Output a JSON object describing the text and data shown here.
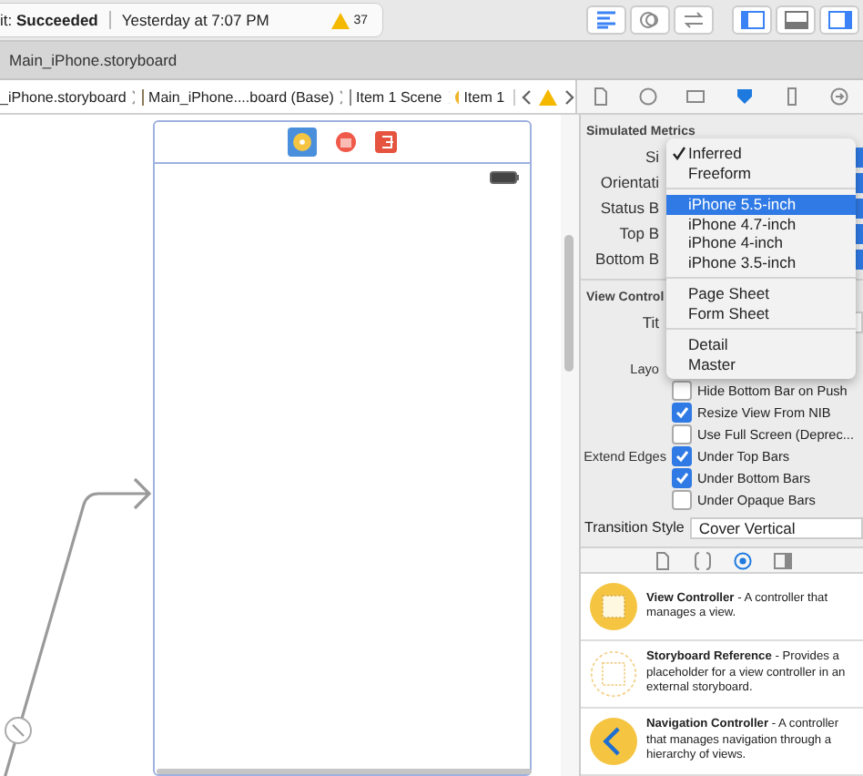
{
  "toolbar": {
    "status": "it: **Succeeded**",
    "time": "Yesterday at 7:07 PM",
    "warning_count": "37",
    "editor_buttons": [
      {
        "selected": true
      },
      {
        "selected": false
      },
      {
        "selected": false
      }
    ],
    "view_buttons": [
      {
        "selected": true
      },
      {
        "selected": false
      },
      {
        "selected": true
      }
    ]
  },
  "tab": {
    "title": "Main_iPhone.storyboard"
  },
  "jump_bar": [
    {
      "label": "_iPhone.storyboard",
      "kind": "file"
    },
    {
      "label": "Main_iPhone....board (Base)",
      "kind": "doc"
    },
    {
      "label": "Item 1 Scene",
      "kind": "scene"
    },
    {
      "label": "Item 1",
      "kind": "controller"
    }
  ],
  "inspector_tabs": [
    {
      "selected": false
    },
    {
      "selected": false
    },
    {
      "selected": false
    },
    {
      "selected": true
    },
    {
      "selected": false
    },
    {
      "selected": false
    }
  ],
  "simulated_metrics": {
    "header": "Simulated Metrics",
    "rows": [
      "Si",
      "Orientati",
      "Status B",
      "Top B",
      "Bottom B"
    ]
  },
  "view_controller": {
    "header": "View Control",
    "title_label": "Tit",
    "layout_label": "Layo",
    "options": [
      {
        "label": "Hide Bottom Bar on Push",
        "checked": false
      },
      {
        "label": "Resize View From NIB",
        "checked": true
      },
      {
        "label": "Use Full Screen (Deprec...",
        "checked": false
      },
      {
        "label": "Under Top Bars",
        "checked": true,
        "group_label": "Extend Edges"
      },
      {
        "label": "Under Bottom Bars",
        "checked": true
      },
      {
        "label": "Under Opaque Bars",
        "checked": false
      }
    ]
  },
  "transition": {
    "label": "Transition Style",
    "value": "Cover Vertical"
  },
  "library_tabs": [
    {
      "selected": false
    },
    {
      "selected": false
    },
    {
      "selected": true
    },
    {
      "selected": false
    }
  ],
  "library": [
    {
      "kind": "view",
      "text": "**View Controller** - A controller that manages a view."
    },
    {
      "kind": "reference",
      "text": "**Storyboard Reference** - Provides a placeholder for a view controller in an external storyboard."
    },
    {
      "kind": "navigation",
      "text": "**Navigation Controller** - A controller that manages navigation through a hierarchy of views."
    }
  ],
  "menu": {
    "groups": [
      [
        {
          "label": "Inferred",
          "checked": true,
          "selected": false
        },
        {
          "label": "Freeform",
          "checked": false,
          "selected": false
        }
      ],
      [
        {
          "label": "iPhone 5.5-inch",
          "checked": false,
          "selected": true
        },
        {
          "label": "iPhone 4.7-inch",
          "checked": false,
          "selected": false
        },
        {
          "label": "iPhone 4-inch",
          "checked": false,
          "selected": false
        },
        {
          "label": "iPhone 3.5-inch",
          "checked": false,
          "selected": false
        }
      ],
      [
        {
          "label": "Page Sheet",
          "checked": false,
          "selected": false
        },
        {
          "label": "Form Sheet",
          "checked": false,
          "selected": false
        }
      ],
      [
        {
          "label": "Detail",
          "checked": false,
          "selected": false
        },
        {
          "label": "Master",
          "checked": false,
          "selected": false
        }
      ]
    ]
  }
}
